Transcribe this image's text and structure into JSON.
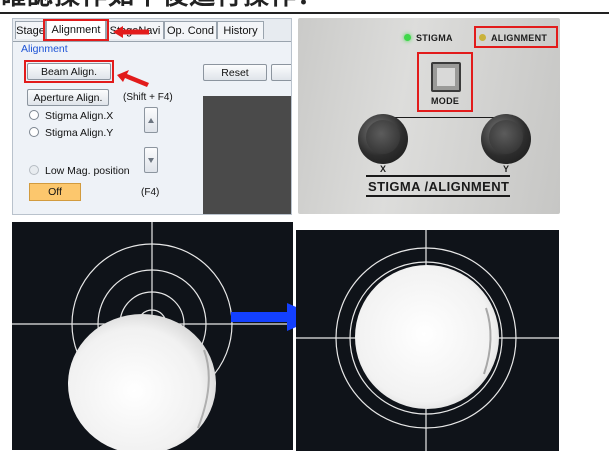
{
  "caption": {
    "text": "確認操作如下後進行操作："
  },
  "software": {
    "tabs": [
      "Stage",
      "Alignment",
      "StageNavi",
      "Op. Cond",
      "History"
    ],
    "active_tab": "Alignment",
    "section_label": "Alignment",
    "beam_align_label": "Beam Align.",
    "reset_label": "Reset",
    "aperture_align_label": "Aperture Align.",
    "shortcut_shift_f4": "(Shift + F4)",
    "radio_stigma_x": "Stigma Align.X",
    "radio_stigma_y": "Stigma Align.Y",
    "radio_low_mag": "Low Mag. position",
    "off_label": "Off",
    "shortcut_f4": "(F4)"
  },
  "hardware": {
    "stigma_indicator": "STIGMA",
    "alignment_indicator": "ALIGNMENT",
    "mode_label": "MODE",
    "knob_x_label": "X",
    "knob_y_label": "Y",
    "panel_title": "STIGMA /ALIGNMENT",
    "stigma_led_color": "#3fd84a",
    "alignment_led_color": "#c9b23a"
  },
  "colors": {
    "highlight": "#e21b1b",
    "transition_arrow": "#1340ff",
    "section_text": "#1c53d6",
    "off_button": "#fcc76d"
  }
}
